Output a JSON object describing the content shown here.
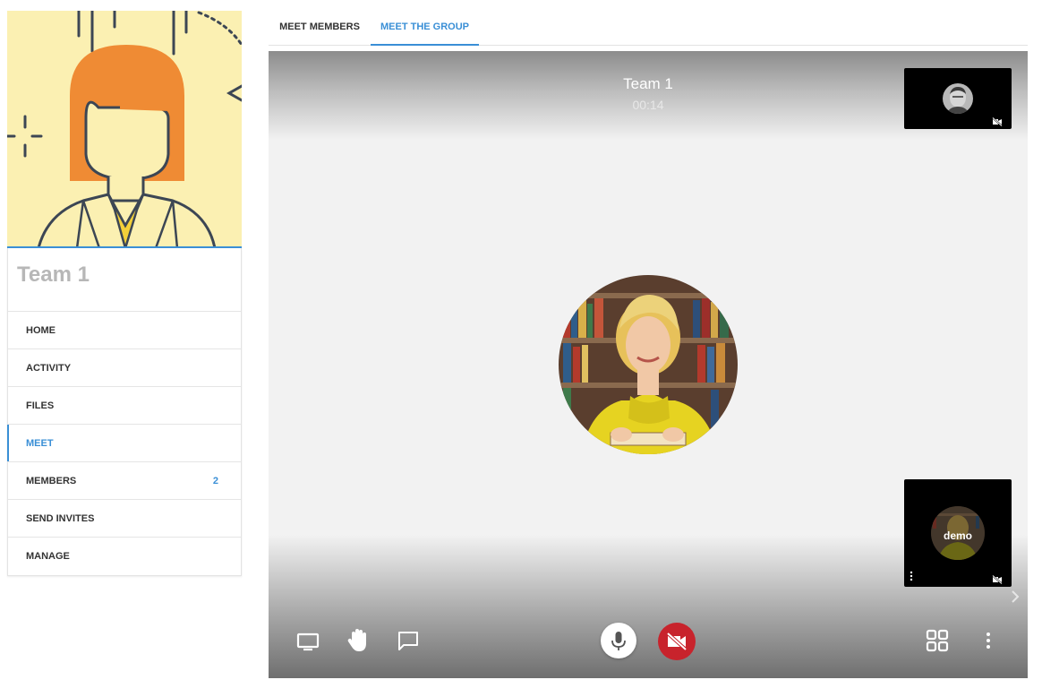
{
  "sidebar": {
    "team_name": "Team 1",
    "items": [
      {
        "label": "HOME"
      },
      {
        "label": "ACTIVITY"
      },
      {
        "label": "FILES"
      },
      {
        "label": "MEET",
        "active": true
      },
      {
        "label": "MEMBERS",
        "badge": "2"
      },
      {
        "label": "SEND INVITES"
      },
      {
        "label": "MANAGE"
      }
    ]
  },
  "tabs": [
    {
      "label": "MEET MEMBERS"
    },
    {
      "label": "MEET THE GROUP",
      "active": true
    }
  ],
  "call": {
    "title": "Team 1",
    "duration": "00:14",
    "participants": [
      {
        "label": "demo",
        "camera": "off",
        "icon": "camera-off-icon"
      }
    ]
  },
  "controls": {
    "icons": [
      "screen-share-icon",
      "raise-hand-icon",
      "chat-icon",
      "microphone-icon",
      "camera-off-icon",
      "grid-view-icon",
      "more-vert-icon"
    ]
  },
  "colors": {
    "accent": "#3a8fd6",
    "camera_button": "#c8232c",
    "cover_background": "#fbf0b2",
    "avatar_hair": "#ef8b34"
  }
}
